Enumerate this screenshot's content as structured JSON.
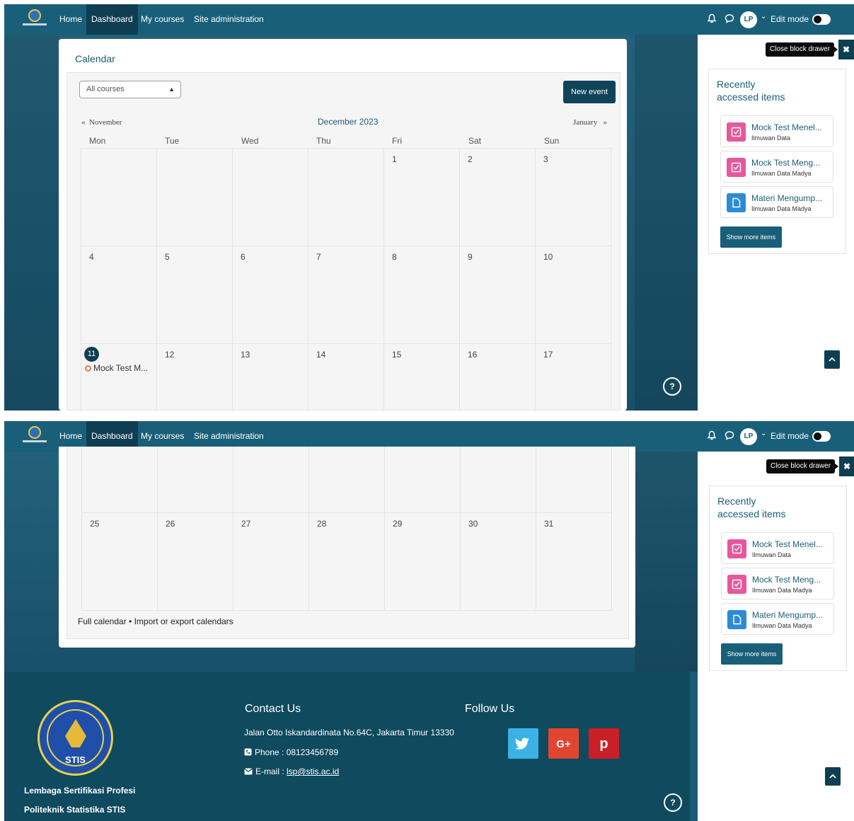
{
  "nav": {
    "home": "Home",
    "dashboard": "Dashboard",
    "my_courses": "My courses",
    "site_admin": "Site administration",
    "avatar_initials": "LP",
    "edit_mode": "Edit mode"
  },
  "calendar": {
    "title": "Calendar",
    "filter_value": "All courses",
    "new_event": "New event",
    "prev_month": "November",
    "current_month": "December 2023",
    "next_month": "January",
    "weekdays": [
      "Mon",
      "Tue",
      "Wed",
      "Thu",
      "Fri",
      "Sat",
      "Sun"
    ],
    "week1": [
      "",
      "",
      "",
      "",
      "1",
      "2",
      "3"
    ],
    "week2": [
      "4",
      "5",
      "6",
      "7",
      "8",
      "9",
      "10"
    ],
    "week3": [
      "11",
      "12",
      "13",
      "14",
      "15",
      "16",
      "17"
    ],
    "week_last": [
      "25",
      "26",
      "27",
      "28",
      "29",
      "30",
      "31"
    ],
    "today": "11",
    "event_label": "Mock Test M...",
    "full_calendar": "Full calendar",
    "separator": "•",
    "import_export": "Import or export calendars"
  },
  "drawer": {
    "close_tooltip": "Close block drawer",
    "close_glyph": "✖",
    "block_title_line1": "Recently",
    "block_title_line2": "accessed items",
    "items": [
      {
        "name": "Mock Test Menel...",
        "course": "Ilmuwan Data",
        "icon": "quiz-icon"
      },
      {
        "name": "Mock Test Meng...",
        "course": "Ilmuwan Data Madya",
        "icon": "quiz-icon"
      },
      {
        "name": "Materi Mengump...",
        "course": "Ilmuwan Data Madya",
        "icon": "file-icon"
      }
    ],
    "show_more": "Show more items"
  },
  "help_glyph": "?",
  "footer": {
    "logo_text": "STIS",
    "org_line1": "Lembaga Sertifikasi Profesi",
    "org_line2": "Politeknik Statistika STIS",
    "contact_heading": "Contact Us",
    "address": "Jalan Otto Iskandardinata No.64C, Jakarta Timur 13330",
    "phone_label": "Phone : 08123456789",
    "email_label": "E-mail : ",
    "email": "lsp@stis.ac.id",
    "follow_heading": "Follow Us",
    "social": {
      "twitter_color": "#3bb2e6",
      "google_color": "#e0452f",
      "google_glyph": "G+",
      "pinterest_color": "#cb1f27",
      "pinterest_glyph": "p"
    }
  },
  "colors": {
    "brand": "#1a5f79",
    "dark": "#0f3e52",
    "pink": "#e8579b",
    "blue": "#2c8bd7"
  }
}
